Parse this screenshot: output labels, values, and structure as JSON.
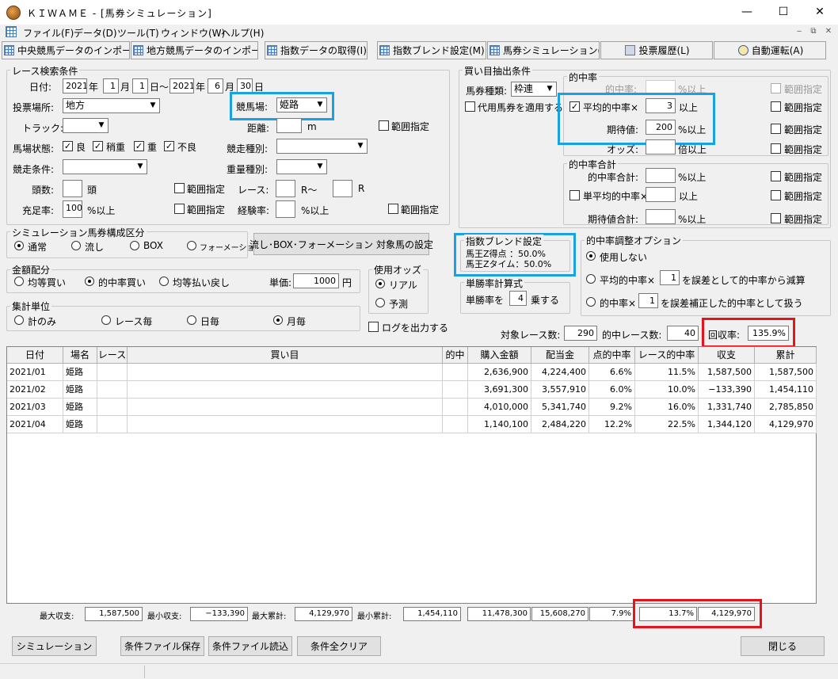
{
  "window": {
    "title": "ＫＩＷＡＭＥ - [馬券シミュレーション]",
    "minimize": "—",
    "maximize": "☐",
    "close": "✕"
  },
  "menu": {
    "items": [
      "ファイル(F)",
      "データ(D)",
      "ツール(T)",
      "ウィンドウ(W)",
      "ヘルプ(H)"
    ],
    "mdi": [
      "‒",
      "⧉",
      "✕"
    ]
  },
  "toolbar": {
    "items": [
      "中央競馬データのインポート(J)",
      "地方競馬データのインポート(N)",
      "指数データの取得(I)",
      "指数ブレンド設定(M)",
      "馬券シミュレーション(B)",
      "投票履歴(L)",
      "自動運転(A)"
    ]
  },
  "race_search": {
    "title": "レース検索条件",
    "date_label": "日付:",
    "from_year": "2021",
    "from_month": "1",
    "from_day": "1",
    "to_year": "2021",
    "to_month": "6",
    "to_day": "30",
    "year": "年",
    "month": "月",
    "day": "日",
    "tilde": "～",
    "venue_label": "投票場所:",
    "venue_value": "地方",
    "track_label": "競馬場:",
    "track_value": "姫路",
    "track_type_label": "トラック:",
    "track_type_value": "",
    "distance_label": "距離:",
    "distance_unit": "m",
    "range": "範囲指定",
    "condition_label": "馬場状態:",
    "cond_good": "良",
    "cond_slight": "稍重",
    "cond_heavy": "重",
    "cond_bad": "不良",
    "race_type_label": "競走種別:",
    "race_cond_label": "競走条件:",
    "weight_type_label": "重量種別:",
    "heads_label": "頭数:",
    "heads_unit": "頭",
    "race_label": "レース:",
    "race_r1": "R～",
    "race_r2": "R",
    "fill_label": "充足率:",
    "fill_value": "100",
    "fill_unit": "%以上",
    "exp_label": "経験率:",
    "exp_unit": "%以上"
  },
  "buy": {
    "title": "買い目抽出条件",
    "ticket_label": "馬券種類:",
    "ticket_value": "枠連",
    "substitute_label": "代用馬券を適用する",
    "hit_group": "的中率",
    "hit_rate": "的中率:",
    "above": "%以上",
    "avg_hit": "平均的中率×",
    "avg_value": "3",
    "avg_unit": "以上",
    "expect_label": "期待値:",
    "expect_value": "200",
    "expect_unit": "%以上",
    "odds_label": "オッズ:",
    "odds_unit": "倍以上",
    "sum_group": "的中率合計",
    "hit_sum": "的中率合計:",
    "single_avg": "単平均的中率×",
    "single_unit": "以上",
    "expect_sum": "期待値合計:",
    "range": "範囲指定"
  },
  "sim": {
    "title": "シミュレーション馬券構成区分",
    "options": [
      "通常",
      "流し",
      "BOX",
      "フォーメーション"
    ],
    "set_button": "流し･BOX･フォーメーション 対象馬の設定"
  },
  "amount": {
    "title": "金額配分",
    "options": [
      "均等買い",
      "的中率買い",
      "均等払い戻し"
    ],
    "unit_label": "単価:",
    "unit_value": "1000",
    "unit": "円"
  },
  "odds_use": {
    "title": "使用オッズ",
    "options": [
      "リアル",
      "予測"
    ]
  },
  "tally": {
    "title": "集計単位",
    "options": [
      "計のみ",
      "レース毎",
      "日毎",
      "月毎"
    ]
  },
  "log_label": "ログを出力する",
  "blend": {
    "title": "指数ブレンド設定",
    "line1": "馬王Z得点 ：50.0%",
    "line2": "馬王Zタイム：50.0%"
  },
  "win_calc": {
    "title": "単勝率計算式",
    "prefix": "単勝率を",
    "value": "4",
    "suffix": "乗する"
  },
  "adjust": {
    "title": "的中率調整オプション",
    "opt1": "使用しない",
    "opt2a": "平均的中率×",
    "opt2v": "1",
    "opt2b": "を誤差として的中率から減算",
    "opt3a": "的中率×",
    "opt3v": "1",
    "opt3b": "を誤差補正した的中率として扱う"
  },
  "stats": {
    "target_label": "対象レース数:",
    "target_value": "290",
    "hit_label": "的中レース数:",
    "hit_value": "40",
    "recovery_label": "回収率:",
    "recovery_value": "135.9%"
  },
  "table": {
    "headers": [
      "日付",
      "場名",
      "レース",
      "買い目",
      "的中",
      "購入金額",
      "配当金",
      "点的中率",
      "レース的中率",
      "収支",
      "累計"
    ],
    "rows": [
      [
        "2021/01",
        "姫路",
        "",
        "",
        "",
        "2,636,900",
        "4,224,400",
        "6.6%",
        "11.5%",
        "1,587,500",
        "1,587,500"
      ],
      [
        "2021/02",
        "姫路",
        "",
        "",
        "",
        "3,691,300",
        "3,557,910",
        "6.0%",
        "10.0%",
        "−133,390",
        "1,454,110"
      ],
      [
        "2021/03",
        "姫路",
        "",
        "",
        "",
        "4,010,000",
        "5,341,740",
        "9.2%",
        "16.0%",
        "1,331,740",
        "2,785,850"
      ],
      [
        "2021/04",
        "姫路",
        "",
        "",
        "",
        "1,140,100",
        "2,484,220",
        "12.2%",
        "22.5%",
        "1,344,120",
        "4,129,970"
      ]
    ]
  },
  "summary": {
    "max_profit_label": "最大収支:",
    "max_profit": "1,587,500",
    "min_profit_label": "最小収支:",
    "min_profit": "−133,390",
    "max_cum_label": "最大累計:",
    "max_cum": "4,129,970",
    "min_cum_label": "最小累計:",
    "min_cum": "1,454,110",
    "total_buy": "11,478,300",
    "total_pay": "15,608,270",
    "point_rate": "7.9%",
    "race_rate": "13.7%",
    "total_cum": "4,129,970"
  },
  "buttons": {
    "simulate": "シミュレーション",
    "save": "条件ファイル保存",
    "load": "条件ファイル読込",
    "clear": "条件全クリア",
    "close": "閉じる"
  }
}
